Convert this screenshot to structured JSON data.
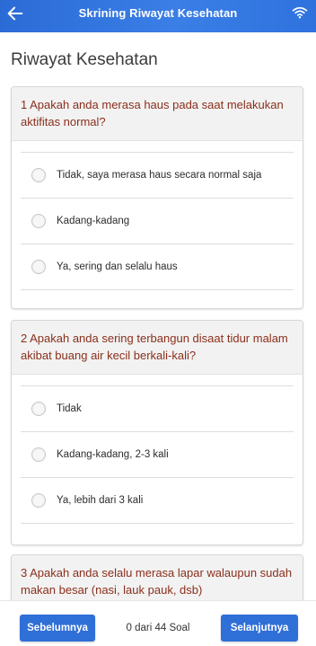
{
  "appbar": {
    "title": "Skrining Riwayat Kesehatan",
    "back_icon": "arrow-left-icon",
    "status_icon": "wifi-icon",
    "color": "#2f72de"
  },
  "page": {
    "title": "Riwayat Kesehatan"
  },
  "questions": [
    {
      "text": "1  Apakah anda merasa haus pada saat melakukan aktifitas normal?",
      "options": [
        "Tidak, saya merasa haus secara normal saja",
        "Kadang-kadang",
        "Ya, sering dan selalu haus"
      ]
    },
    {
      "text": "2  Apakah anda sering terbangun disaat tidur malam akibat buang air kecil berkali-kali?",
      "options": [
        "Tidak",
        "Kadang-kadang, 2-3 kali",
        "Ya, lebih dari 3 kali"
      ]
    },
    {
      "text": "3  Apakah anda selalu merasa lapar walaupun sudah makan besar (nasi, lauk pauk, dsb)",
      "options": []
    }
  ],
  "footer": {
    "prev_label": "Sebelumnya",
    "counter": "0 dari 44 Soal",
    "next_label": "Selanjutnya"
  },
  "colors": {
    "question_text": "#8a2f1c",
    "button": "#2f6fd8"
  }
}
